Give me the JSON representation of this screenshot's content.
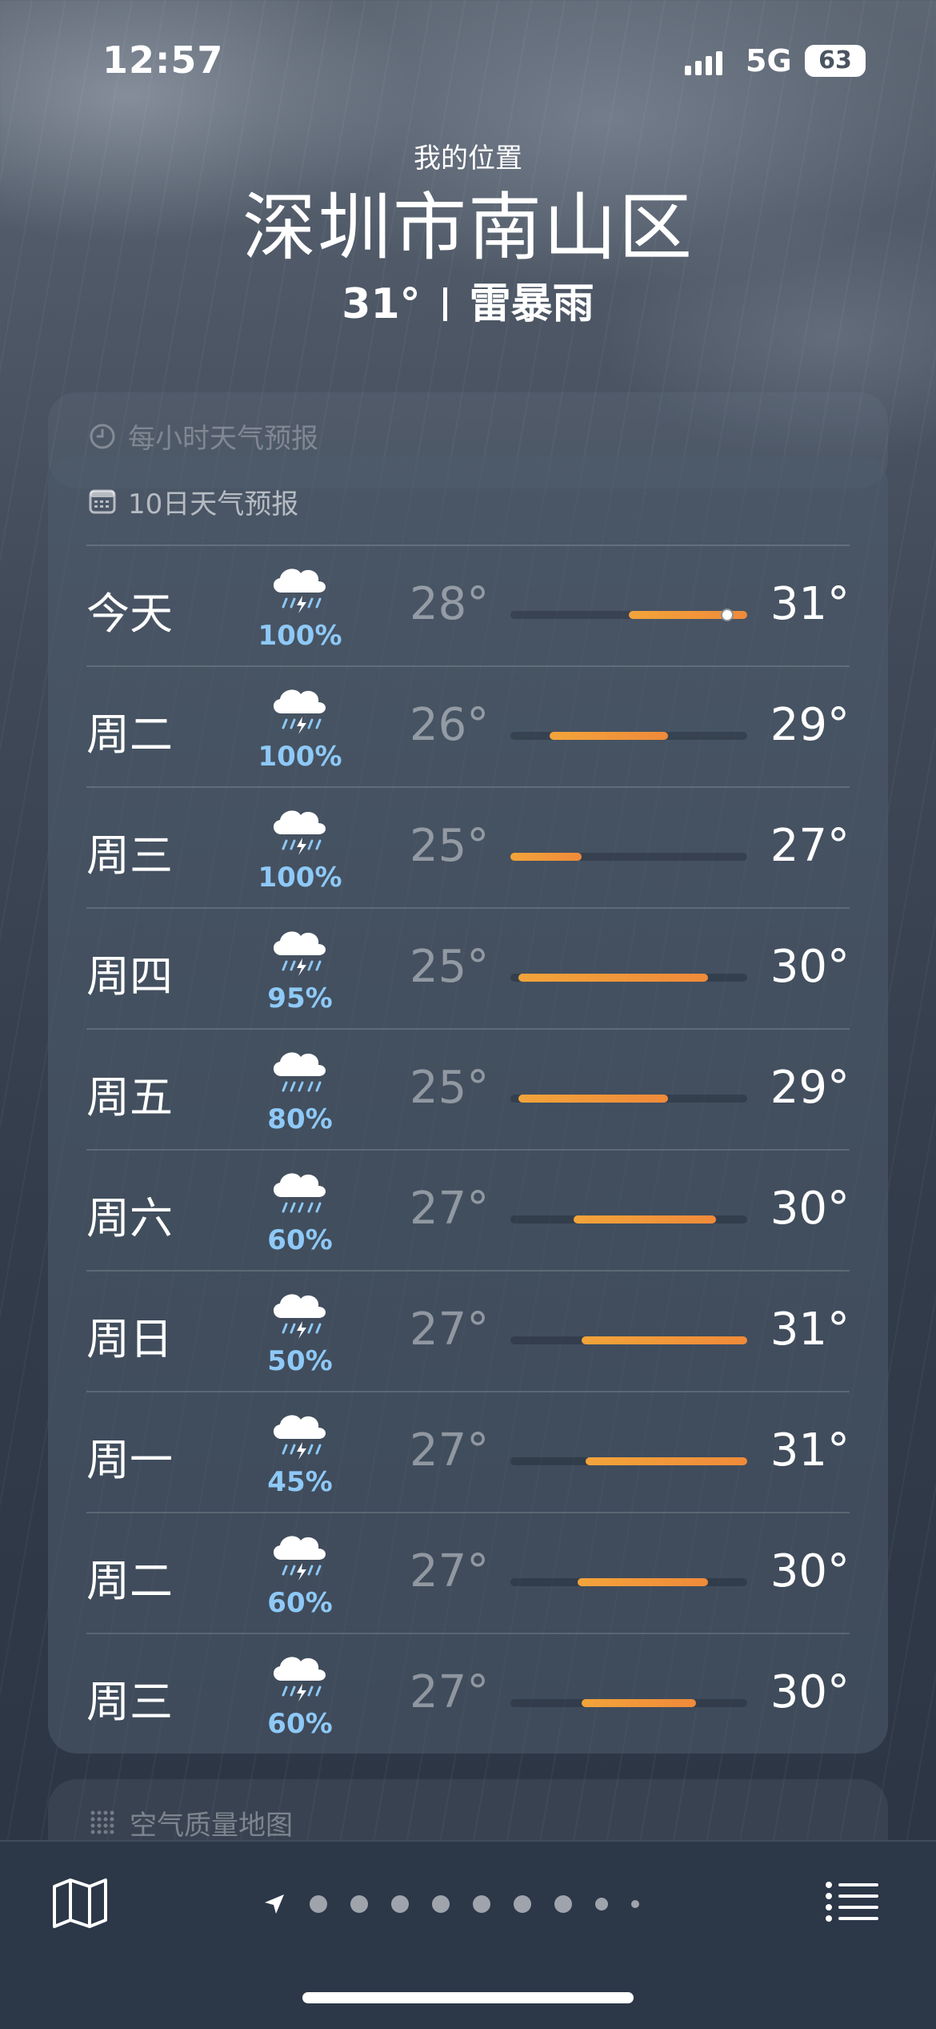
{
  "status_bar": {
    "time": "12:57",
    "network": "5G",
    "battery": "63"
  },
  "header": {
    "my_location": "我的位置",
    "city": "深圳市南山区",
    "current_temp": "31°",
    "condition": "雷暴雨"
  },
  "hourly": {
    "title": "每小时天气预报",
    "icon": "clock-icon"
  },
  "forecast": {
    "title": "10日天气预报",
    "icon": "calendar-icon",
    "range_min": 25,
    "range_max": 31,
    "current_temp_marker": 30.5,
    "days": [
      {
        "day": "今天",
        "icon": "thunderstorm-icon",
        "precip": "100%",
        "low": "28°",
        "high": "31°",
        "low_val": 28,
        "high_val": 31
      },
      {
        "day": "周二",
        "icon": "thunderstorm-icon",
        "precip": "100%",
        "low": "26°",
        "high": "29°",
        "low_val": 26,
        "high_val": 29
      },
      {
        "day": "周三",
        "icon": "thunderstorm-icon",
        "precip": "100%",
        "low": "25°",
        "high": "27°",
        "low_val": 25,
        "high_val": 26.8
      },
      {
        "day": "周四",
        "icon": "thunderstorm-icon",
        "precip": "95%",
        "low": "25°",
        "high": "30°",
        "low_val": 25.2,
        "high_val": 30
      },
      {
        "day": "周五",
        "icon": "rain-icon",
        "precip": "80%",
        "low": "25°",
        "high": "29°",
        "low_val": 25.2,
        "high_val": 29
      },
      {
        "day": "周六",
        "icon": "rain-icon",
        "precip": "60%",
        "low": "27°",
        "high": "30°",
        "low_val": 26.6,
        "high_val": 30.2
      },
      {
        "day": "周日",
        "icon": "thunderstorm-icon",
        "precip": "50%",
        "low": "27°",
        "high": "31°",
        "low_val": 26.8,
        "high_val": 31
      },
      {
        "day": "周一",
        "icon": "thunderstorm-icon",
        "precip": "45%",
        "low": "27°",
        "high": "31°",
        "low_val": 26.9,
        "high_val": 31
      },
      {
        "day": "周二",
        "icon": "thunderstorm-icon",
        "precip": "60%",
        "low": "27°",
        "high": "30°",
        "low_val": 26.7,
        "high_val": 30
      },
      {
        "day": "周三",
        "icon": "thunderstorm-icon",
        "precip": "60%",
        "low": "27°",
        "high": "30°",
        "low_val": 26.8,
        "high_val": 29.7
      }
    ]
  },
  "air_quality": {
    "title": "空气质量地图",
    "icon": "grid-dots-icon"
  },
  "toolbar": {
    "map_icon": "map-icon",
    "location_icon": "location-arrow-icon",
    "list_icon": "list-icon",
    "page_count": 9,
    "current_page": 0
  },
  "colors": {
    "temp_bar": "#f08a3a",
    "precip": "#8ec9f7"
  }
}
